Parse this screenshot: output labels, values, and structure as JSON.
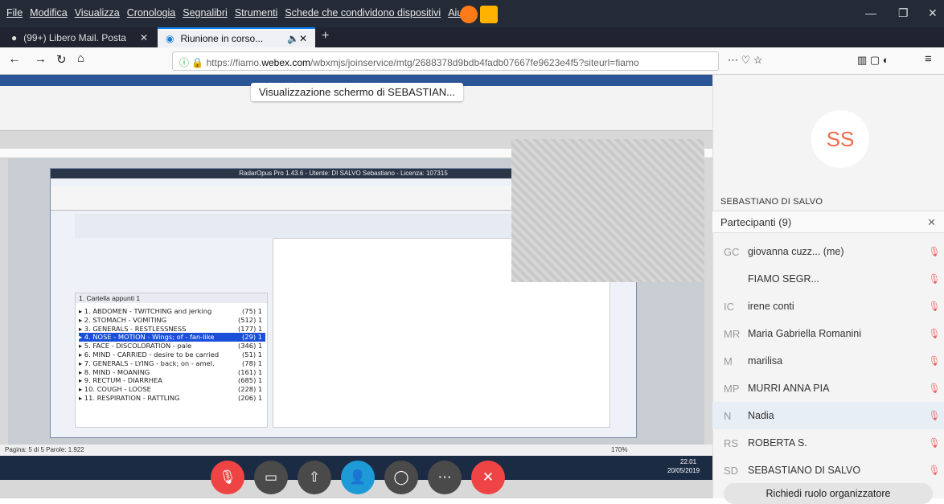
{
  "browser": {
    "menu": [
      "File",
      "Modifica",
      "Visualizza",
      "Cronologia",
      "Segnalibri",
      "Strumenti",
      "Schede che condividono dispositivi",
      "Aiuto"
    ],
    "tabs": [
      {
        "label": "(99+) Libero Mail. Posta"
      },
      {
        "label": "Riunione in corso..."
      }
    ],
    "url_prefix": "https://fiamo.",
    "url_domain": "webex.com",
    "url_rest": "/wbxmjs/joinservice/mtg/2688378d9bdb4fadb07667fe9623e4f5?siteurl=fiamo"
  },
  "share": {
    "label": "Visualizzazione schermo di SEBASTIAN...",
    "radar_title": "RadarOpus Pro 1.43.6 - Utente: DI SALVO Sebastiano - Licenza: 107315",
    "clipboard": "1. Cartella appunti 1",
    "rubrics": [
      {
        "t": "1. ABDOMEN - TWITCHING and jerking",
        "c": "(75) 1"
      },
      {
        "t": "2. STOMACH - VOMITING",
        "c": "(512) 1"
      },
      {
        "t": "3. GENERALS - RESTLESSNESS",
        "c": "(177) 1"
      },
      {
        "t": "4. NOSE - MOTION - Wings; of - fan-like",
        "c": "(29) 1"
      },
      {
        "t": "5. FACE - DISCOLORATION - pale",
        "c": "(346) 1"
      },
      {
        "t": "6. MIND - CARRIED - desire to be carried",
        "c": "(51) 1"
      },
      {
        "t": "7. GENERALS - LYING - back; on - amel.",
        "c": "(78) 1"
      },
      {
        "t": "8. MIND - MOANING",
        "c": "(161) 1"
      },
      {
        "t": "9. RECTUM - DIARRHEA",
        "c": "(685) 1"
      },
      {
        "t": "10. COUGH - LOOSE",
        "c": "(228) 1"
      },
      {
        "t": "11. RESPIRATION - RATTLING",
        "c": "(206) 1"
      }
    ],
    "status": "Pagina: 5 di 5   Parole: 1.922",
    "clock": "22.01",
    "date": "20/05/2019",
    "zoom": "170%"
  },
  "panel": {
    "avatar": "SS",
    "presenter": "SEBASTIANO DI SALVO",
    "participants_title": "Partecipanti (9)",
    "participants": [
      {
        "init": "GC",
        "name": "giovanna cuzz...",
        "me": "(me)"
      },
      {
        "init": "",
        "name": "FIAMO SEGR..."
      },
      {
        "init": "IC",
        "name": "irene conti"
      },
      {
        "init": "MR",
        "name": "Maria Gabriella Romanini"
      },
      {
        "init": "M",
        "name": "marilisa"
      },
      {
        "init": "MP",
        "name": "MURRI ANNA PIA"
      },
      {
        "init": "N",
        "name": "Nadia"
      },
      {
        "init": "RS",
        "name": "ROBERTA S."
      },
      {
        "init": "SD",
        "name": "SEBASTIANO DI SALVO"
      }
    ],
    "request_button": "Richiedi ruolo organizzatore"
  }
}
